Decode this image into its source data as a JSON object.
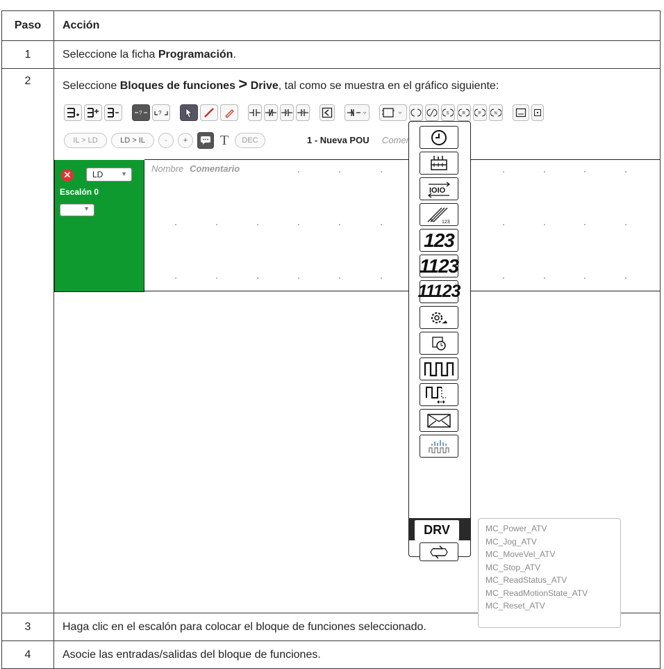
{
  "table": {
    "header": {
      "step": "Paso",
      "action": "Acción"
    },
    "rows": [
      {
        "step": "1",
        "prefix": "Seleccione la ficha ",
        "bold": "Programación",
        "suffix": "."
      },
      {
        "step": "2",
        "prefix": "Seleccione ",
        "bold1": "Bloques de funciones",
        "gt": ">",
        "bold2": "Drive",
        "suffix": ", tal como se muestra en el gráfico siguiente:"
      },
      {
        "step": "3",
        "text": "Haga clic en el escalón para colocar el bloque de funciones seleccionado."
      },
      {
        "step": "4",
        "text": "Asocie las entradas/salidas del bloque de funciones."
      }
    ]
  },
  "screenshot": {
    "toolbar2": {
      "il_ld": "IL > LD",
      "ld_il": "LD > IL",
      "minus": "-",
      "plus": "+",
      "text_tool": "T",
      "dec": "DEC"
    },
    "pou_title": "1 - Nueva POU",
    "comment_header": "Comen",
    "rung": {
      "lang": "LD",
      "label": "Escalón 0"
    },
    "columns": {
      "name": "Nombre",
      "comment": "Comentario"
    },
    "palette": {
      "n1": "123",
      "n2": "1123",
      "n3": "11123",
      "drv": "DRV"
    },
    "submenu": [
      "MC_Power_ATV",
      "MC_Jog_ATV",
      "MC_MoveVel_ATV",
      "MC_Stop_ATV",
      "MC_ReadStatus_ATV",
      "MC_ReadMotionState_ATV",
      "MC_Reset_ATV"
    ]
  }
}
